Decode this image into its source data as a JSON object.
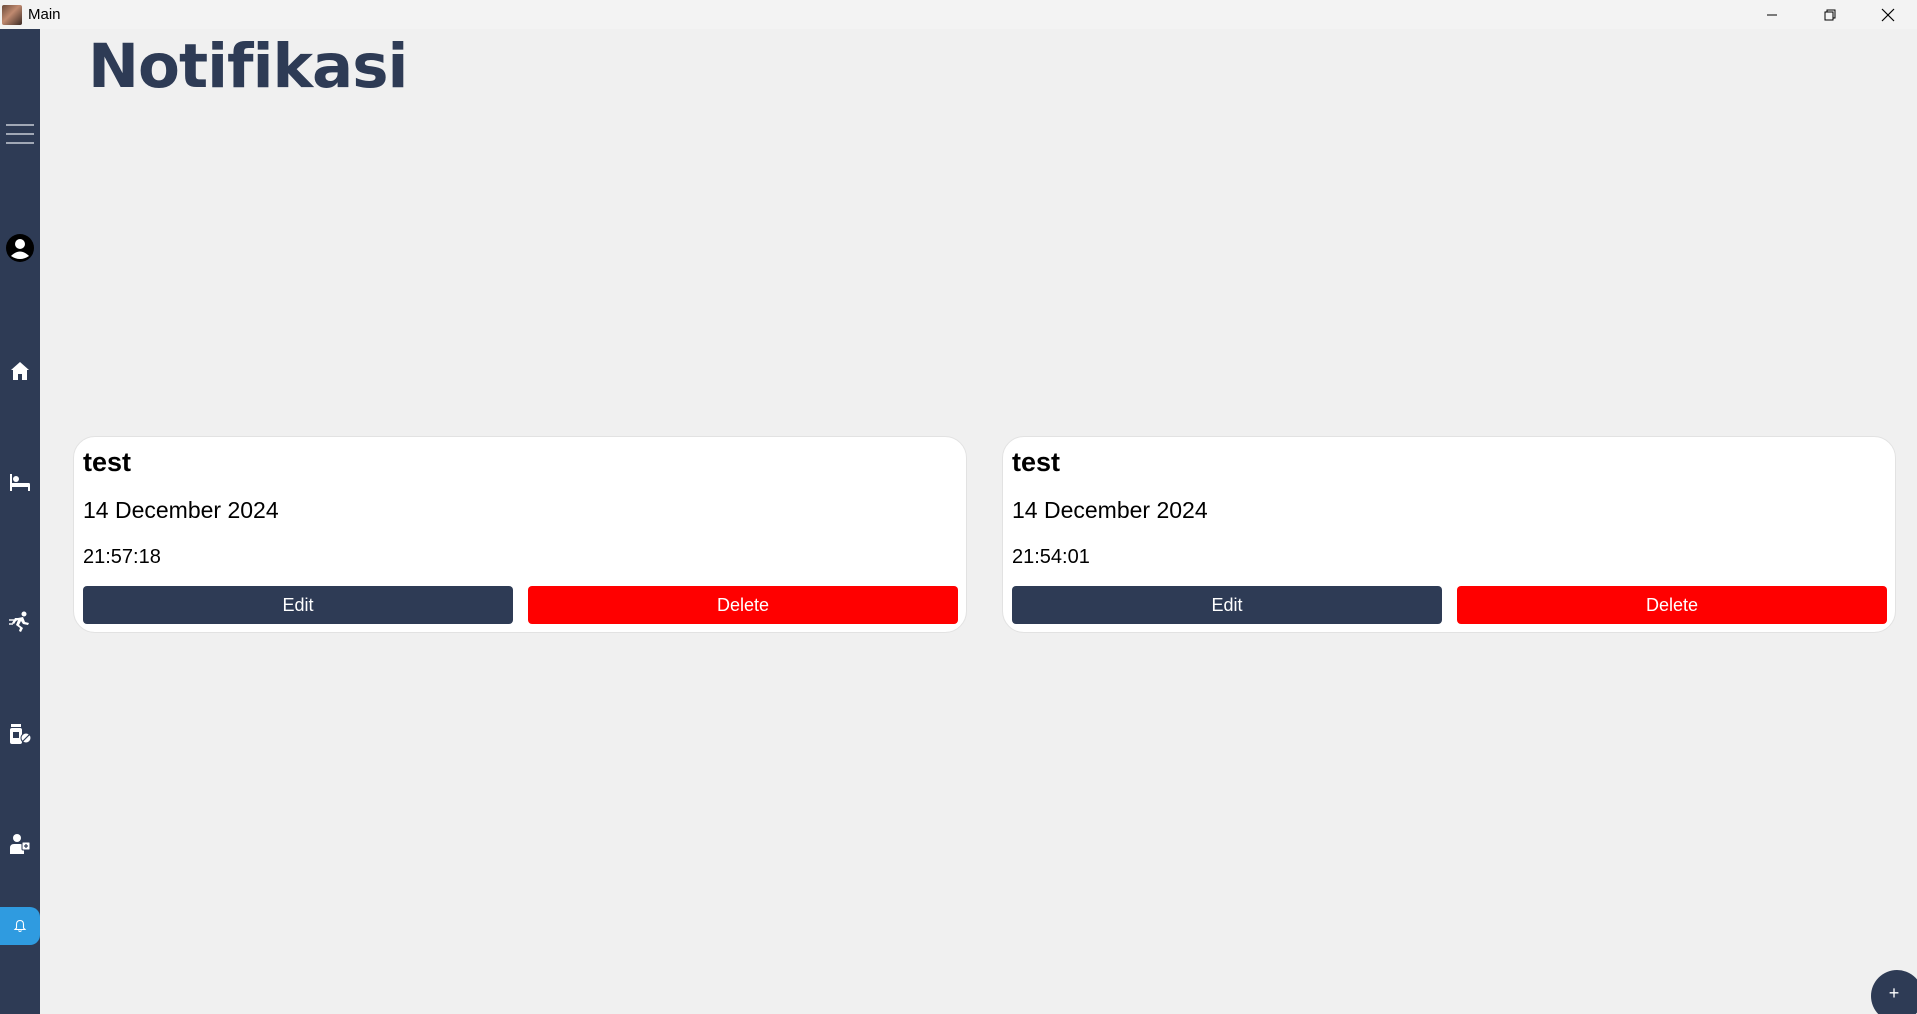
{
  "window": {
    "title": "Main",
    "icon": "app-avatar-icon",
    "controls": [
      "minimize-icon",
      "restore-icon",
      "close-icon"
    ]
  },
  "sidebar": {
    "items": [
      {
        "name": "menu",
        "icon": "hamburger-icon"
      },
      {
        "name": "profile",
        "icon": "user-circle-icon"
      },
      {
        "name": "home",
        "icon": "home-icon"
      },
      {
        "name": "rest",
        "icon": "bed-icon"
      },
      {
        "name": "exercise",
        "icon": "running-icon"
      },
      {
        "name": "medicine",
        "icon": "medicine-icon"
      },
      {
        "name": "doctor",
        "icon": "doctor-icon"
      },
      {
        "name": "notifications",
        "icon": "bell-icon",
        "active": true
      }
    ],
    "active_color": "#2f9be0",
    "background": "#2e3b55"
  },
  "page": {
    "title": "Notifikasi"
  },
  "notifications": [
    {
      "title": "test",
      "date": "14 December 2024",
      "time": "21:57:18",
      "edit_label": "Edit",
      "delete_label": "Delete"
    },
    {
      "title": "test",
      "date": "14 December 2024",
      "time": "21:54:01",
      "edit_label": "Edit",
      "delete_label": "Delete"
    }
  ],
  "fab": {
    "label": "+"
  },
  "colors": {
    "primary": "#2e3b55",
    "danger": "#ff0000",
    "background": "#f0f0f0",
    "card": "#ffffff"
  }
}
